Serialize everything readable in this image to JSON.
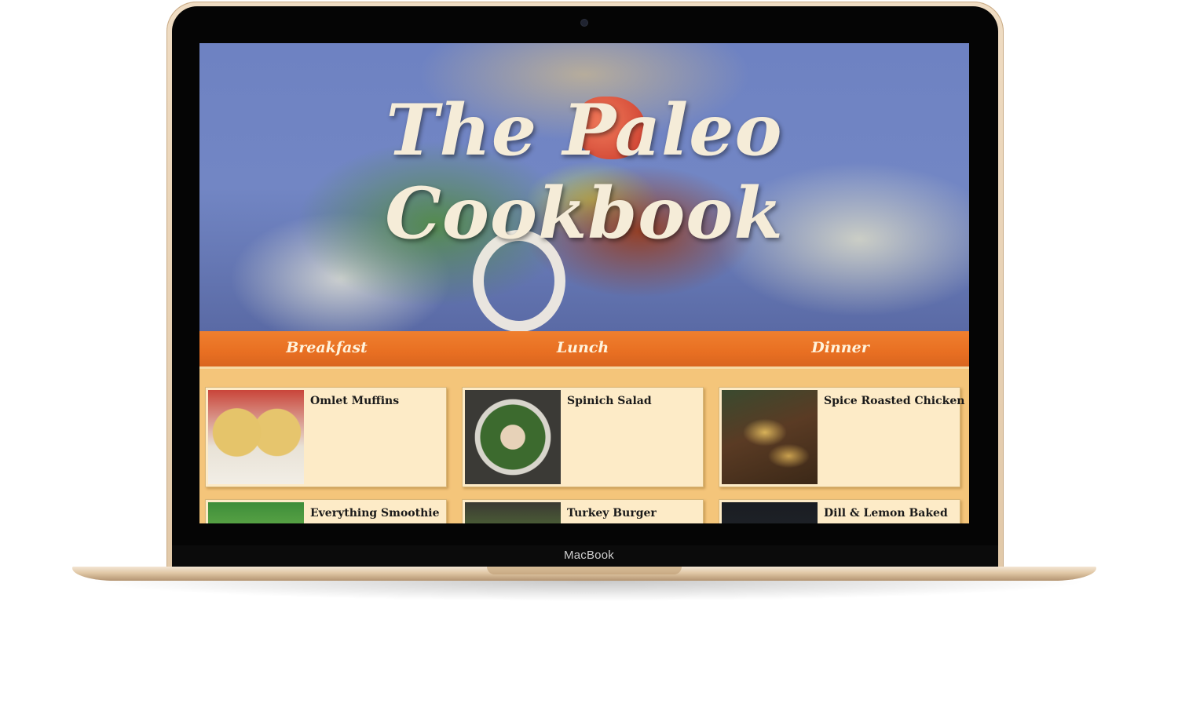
{
  "device": {
    "brand_label": "MacBook"
  },
  "site": {
    "title": "The Paleo Cookbook",
    "nav": [
      {
        "label": "Breakfast"
      },
      {
        "label": "Lunch"
      },
      {
        "label": "Dinner"
      }
    ],
    "recipes": [
      {
        "title": "Omlet Muffins",
        "image": "muffins-photo"
      },
      {
        "title": "Spinich Salad",
        "image": "salad-photo"
      },
      {
        "title": "Spice Roasted Chicken",
        "image": "chicken-photo"
      },
      {
        "title": "Everything Smoothie",
        "image": "smoothie-photo"
      },
      {
        "title": "Turkey Burger",
        "image": "burger-photo"
      },
      {
        "title": "Dill & Lemon Baked",
        "image": "fish-photo"
      }
    ]
  },
  "colors": {
    "nav_orange": "#e86f22",
    "grid_background": "#f4c57a",
    "card_background": "#fdebc7",
    "title_cream": "#f5ecd8",
    "laptop_gold": "#e2c9a9"
  }
}
